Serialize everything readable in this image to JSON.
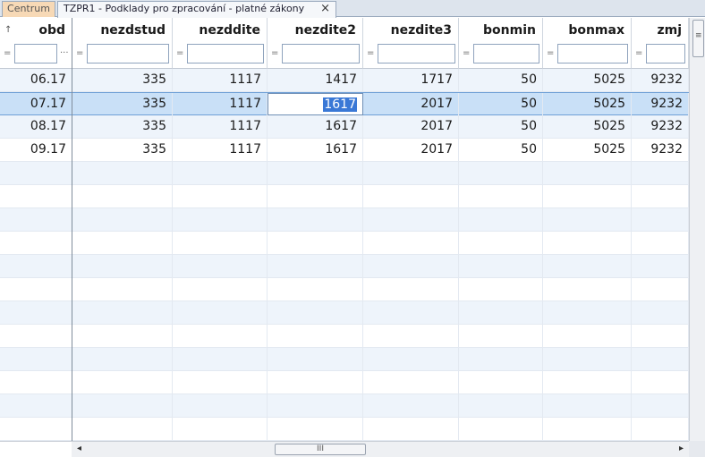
{
  "tabs": {
    "centrum_label": "Centrum",
    "active_label": "TZPR1 - Podklady pro zpracování - platné zákony",
    "close_glyph": "×"
  },
  "grid": {
    "sort_indicator": "↑",
    "filter_operator": "=",
    "filter_more": "···",
    "columns": [
      "obd",
      "nezdstud",
      "nezddite",
      "nezdite2",
      "nezdite3",
      "bonmin",
      "bonmax",
      "zmj"
    ],
    "rows": [
      [
        "06.17",
        "335",
        "1117",
        "1417",
        "1717",
        "50",
        "5025",
        "9232"
      ],
      [
        "07.17",
        "335",
        "1117",
        "1617",
        "2017",
        "50",
        "5025",
        "9232"
      ],
      [
        "08.17",
        "335",
        "1117",
        "1617",
        "2017",
        "50",
        "5025",
        "9232"
      ],
      [
        "09.17",
        "335",
        "1117",
        "1617",
        "2017",
        "50",
        "5025",
        "9232"
      ]
    ],
    "selected_row_index": 1,
    "editing_cell": {
      "row": 1,
      "column": "nezdite2"
    },
    "hscroll_grip": "III"
  },
  "colors": {
    "selected_row": "#c9e0f7",
    "alt_row": "#eef4fb",
    "selection_highlight": "#3a78d6",
    "centrum_tab": "#f7d9b6"
  },
  "icons": {
    "scroll_left": "◂",
    "scroll_right": "▸"
  }
}
